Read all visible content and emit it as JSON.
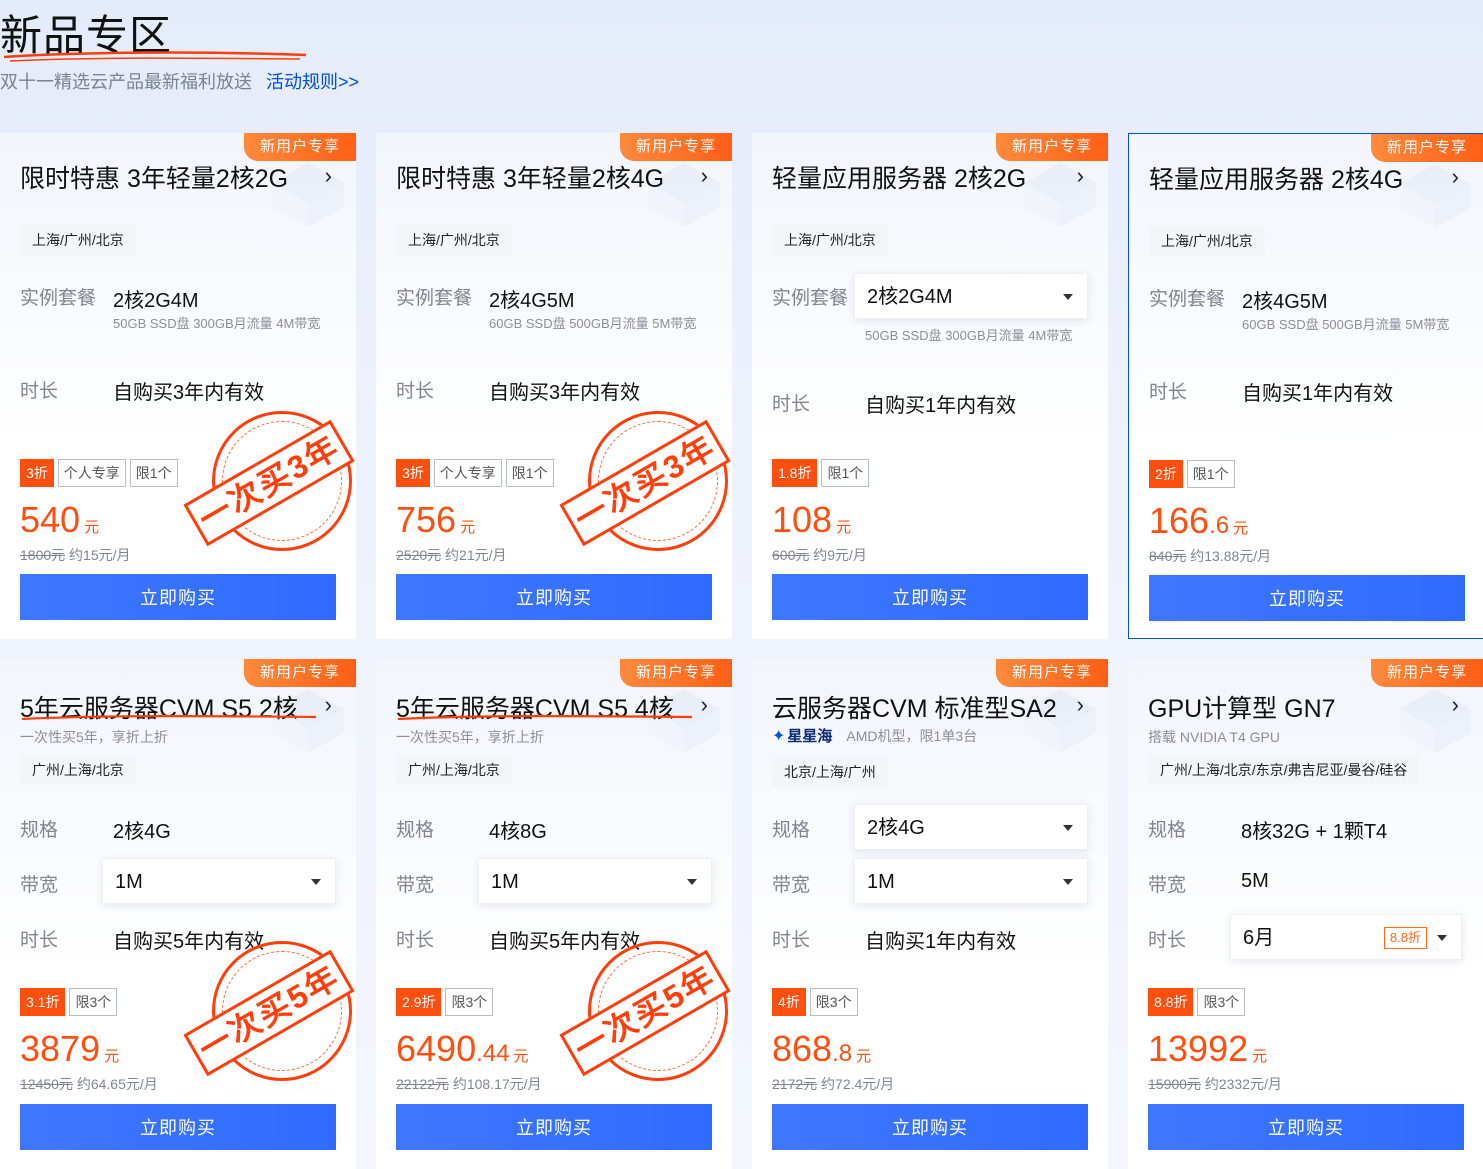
{
  "section": {
    "title": "新品专区",
    "subtitle": "双十一精选云产品最新福利放送",
    "rule_link": "活动规则>>"
  },
  "accent": "#ff4f0f",
  "brand_blue": "#0052d9",
  "cards": [
    {
      "badge": "新用户专享",
      "name": "限时特惠 3年轻量2核2G",
      "region": "上海/广州/北京",
      "label1": "实例套餐",
      "value1": "2核2G4M",
      "desc1": "50GB SSD盘 300GB月流量 4M带宽",
      "label2": "时长",
      "value2": "自购买3年内有效",
      "tags": [
        "3折",
        "个人专享",
        "限1个"
      ],
      "price": "540",
      "price_dec": "",
      "unit": "元",
      "orig": "1800元",
      "monthly": "约15元/月",
      "buy": "立即购买",
      "stamp": "一次买3年"
    },
    {
      "badge": "新用户专享",
      "name": "限时特惠 3年轻量2核4G",
      "region": "上海/广州/北京",
      "label1": "实例套餐",
      "value1": "2核4G5M",
      "desc1": "60GB SSD盘 500GB月流量 5M带宽",
      "label2": "时长",
      "value2": "自购买3年内有效",
      "tags": [
        "3折",
        "个人专享",
        "限1个"
      ],
      "price": "756",
      "price_dec": "",
      "unit": "元",
      "orig": "2520元",
      "monthly": "约21元/月",
      "buy": "立即购买",
      "stamp": "一次买3年"
    },
    {
      "badge": "新用户专享",
      "name": "轻量应用服务器 2核2G",
      "region": "上海/广州/北京",
      "label1": "实例套餐",
      "value1": "2核2G4M",
      "desc1": "50GB SSD盘 300GB月流量 4M带宽",
      "label2": "时长",
      "value2": "自购买1年内有效",
      "tags": [
        "1.8折",
        "限1个"
      ],
      "price": "108",
      "price_dec": "",
      "unit": "元",
      "orig": "600元",
      "monthly": "约9元/月",
      "buy": "立即购买"
    },
    {
      "badge": "新用户专享",
      "name": "轻量应用服务器 2核4G",
      "region": "上海/广州/北京",
      "label1": "实例套餐",
      "value1": "2核4G5M",
      "desc1": "60GB SSD盘 500GB月流量 5M带宽",
      "label2": "时长",
      "value2": "自购买1年内有效",
      "tags": [
        "2折",
        "限1个"
      ],
      "price": "166",
      "price_dec": ".6",
      "unit": "元",
      "orig": "840元",
      "monthly": "约13.88元/月",
      "buy": "立即购买"
    },
    {
      "badge": "新用户专享",
      "name": "5年云服务器CVM S5 2核",
      "sub": "一次性买5年，享折上折",
      "region": "广州/上海/北京",
      "label1": "规格",
      "value1": "2核4G",
      "label2": "带宽",
      "value2": "1M",
      "label3": "时长",
      "value3": "自购买5年内有效",
      "tags": [
        "3.1折",
        "限3个"
      ],
      "price": "3879",
      "price_dec": "",
      "unit": "元",
      "orig": "12450元",
      "monthly": "约64.65元/月",
      "buy": "立即购买",
      "stamp": "一次买5年"
    },
    {
      "badge": "新用户专享",
      "name": "5年云服务器CVM S5 4核",
      "sub": "一次性买5年，享折上折",
      "region": "广州/上海/北京",
      "label1": "规格",
      "value1": "4核8G",
      "label2": "带宽",
      "value2": "1M",
      "label3": "时长",
      "value3": "自购买5年内有效",
      "tags": [
        "2.9折",
        "限3个"
      ],
      "price": "6490",
      "price_dec": ".44",
      "unit": "元",
      "orig": "22122元",
      "monthly": "约108.17元/月",
      "buy": "立即购买",
      "stamp": "一次买5年"
    },
    {
      "badge": "新用户专享",
      "name": "云服务器CVM 标准型SA2",
      "brand": "星星海",
      "brand_desc": "AMD机型，限1单3台",
      "region": "北京/上海/广州",
      "label1": "规格",
      "value1": "2核4G",
      "label2": "带宽",
      "value2": "1M",
      "label3": "时长",
      "value3": "自购买1年内有效",
      "tags": [
        "4折",
        "限3个"
      ],
      "price": "868",
      "price_dec": ".8",
      "unit": "元",
      "orig": "2172元",
      "monthly": "约72.4元/月",
      "buy": "立即购买"
    },
    {
      "badge": "新用户专享",
      "name": "GPU计算型 GN7",
      "sub": "搭载 NVIDIA T4 GPU",
      "region": "广州/上海/北京/东京/弗吉尼亚/曼谷/硅谷",
      "label1": "规格",
      "value1": "8核32G + 1颗T4",
      "label2": "带宽",
      "value2": "5M",
      "label3": "时长",
      "value3": "6月",
      "value3_tag": "8.8折",
      "tags": [
        "8.8折",
        "限3个"
      ],
      "price": "13992",
      "price_dec": "",
      "unit": "元",
      "orig": "15900元",
      "monthly": "约2332元/月",
      "buy": "立即购买"
    }
  ]
}
